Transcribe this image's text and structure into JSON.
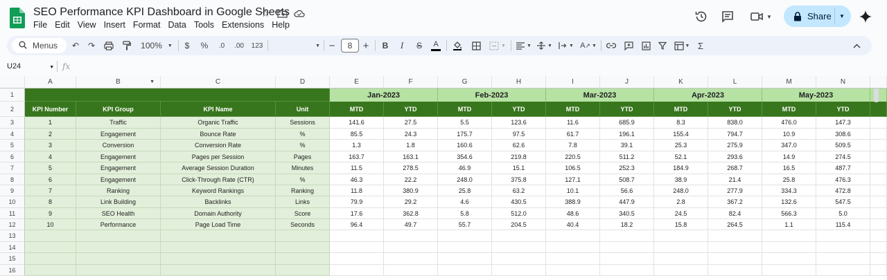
{
  "app": {
    "title": "SEO Performance KPI Dashboard in Google Sheets",
    "menu": [
      "File",
      "Edit",
      "View",
      "Insert",
      "Format",
      "Data",
      "Tools",
      "Extensions",
      "Help"
    ],
    "share_label": "Share",
    "brand_color": "#0f9d58"
  },
  "toolbar": {
    "menus_label": "Menus",
    "zoom": "100%",
    "currency": "$",
    "percent": "%",
    "dec_decrease": ".0",
    "dec_increase": ".00",
    "format_123": "123",
    "font_size": "8"
  },
  "formula_bar": {
    "cell_ref": "U24",
    "fx": "fx",
    "content": ""
  },
  "sheet": {
    "columns": [
      "A",
      "B",
      "C",
      "D",
      "E",
      "F",
      "G",
      "H",
      "I",
      "J",
      "K",
      "L",
      "M",
      "N"
    ],
    "rows": [
      "1",
      "2",
      "3",
      "4",
      "5",
      "6",
      "7",
      "8",
      "9",
      "10",
      "11",
      "12",
      "13",
      "14",
      "15",
      "16"
    ],
    "months": [
      "Jan-2023",
      "Feb-2023",
      "Mar-2023",
      "Apr-2023",
      "May-2023"
    ],
    "headers": [
      "KPI Number",
      "KPI Group",
      "KPI Name",
      "Unit"
    ],
    "sub_headers": [
      "MTD",
      "YTD"
    ],
    "header_color": "#38761d",
    "month_color": "#b6e2a4",
    "kpi_area_color": "#e2efda",
    "data": [
      [
        "1",
        "Traffic",
        "Organic Traffic",
        "Sessions",
        "141.6",
        "27.5",
        "5.5",
        "123.6",
        "11.6",
        "685.9",
        "8.3",
        "838.0",
        "476.0",
        "147.3"
      ],
      [
        "2",
        "Engagement",
        "Bounce Rate",
        "%",
        "85.5",
        "24.3",
        "175.7",
        "97.5",
        "61.7",
        "196.1",
        "155.4",
        "794.7",
        "10.9",
        "308.6"
      ],
      [
        "3",
        "Conversion",
        "Conversion Rate",
        "%",
        "1.3",
        "1.8",
        "160.6",
        "62.6",
        "7.8",
        "39.1",
        "25.3",
        "275.9",
        "347.0",
        "509.5"
      ],
      [
        "4",
        "Engagement",
        "Pages per Session",
        "Pages",
        "163.7",
        "163.1",
        "354.6",
        "219.8",
        "220.5",
        "511.2",
        "52.1",
        "293.6",
        "14.9",
        "274.5"
      ],
      [
        "5",
        "Engagement",
        "Average Session Duration",
        "Minutes",
        "11.5",
        "278.5",
        "46.9",
        "15.1",
        "106.5",
        "252.3",
        "184.9",
        "268.7",
        "16.5",
        "487.7"
      ],
      [
        "6",
        "Engagement",
        "Click-Through Rate (CTR)",
        "%",
        "46.3",
        "22.2",
        "248.0",
        "375.8",
        "127.1",
        "508.7",
        "38.9",
        "21.4",
        "25.8",
        "476.3"
      ],
      [
        "7",
        "Ranking",
        "Keyword Rankings",
        "Ranking",
        "11.8",
        "380.9",
        "25.8",
        "63.2",
        "10.1",
        "56.6",
        "248.0",
        "277.9",
        "334.3",
        "472.8"
      ],
      [
        "8",
        "Link Building",
        "Backlinks",
        "Links",
        "79.9",
        "29.2",
        "4.6",
        "430.5",
        "388.9",
        "447.9",
        "2.8",
        "367.2",
        "132.6",
        "547.5"
      ],
      [
        "9",
        "SEO Health",
        "Domain Authority",
        "Score",
        "17.6",
        "362.8",
        "5.8",
        "512.0",
        "48.6",
        "340.5",
        "24.5",
        "82.4",
        "566.3",
        "5.0"
      ],
      [
        "10",
        "Performance",
        "Page Load Time",
        "Seconds",
        "96.4",
        "49.7",
        "55.7",
        "204.5",
        "40.4",
        "18.2",
        "15.8",
        "264.5",
        "1.1",
        "115.4"
      ]
    ]
  }
}
